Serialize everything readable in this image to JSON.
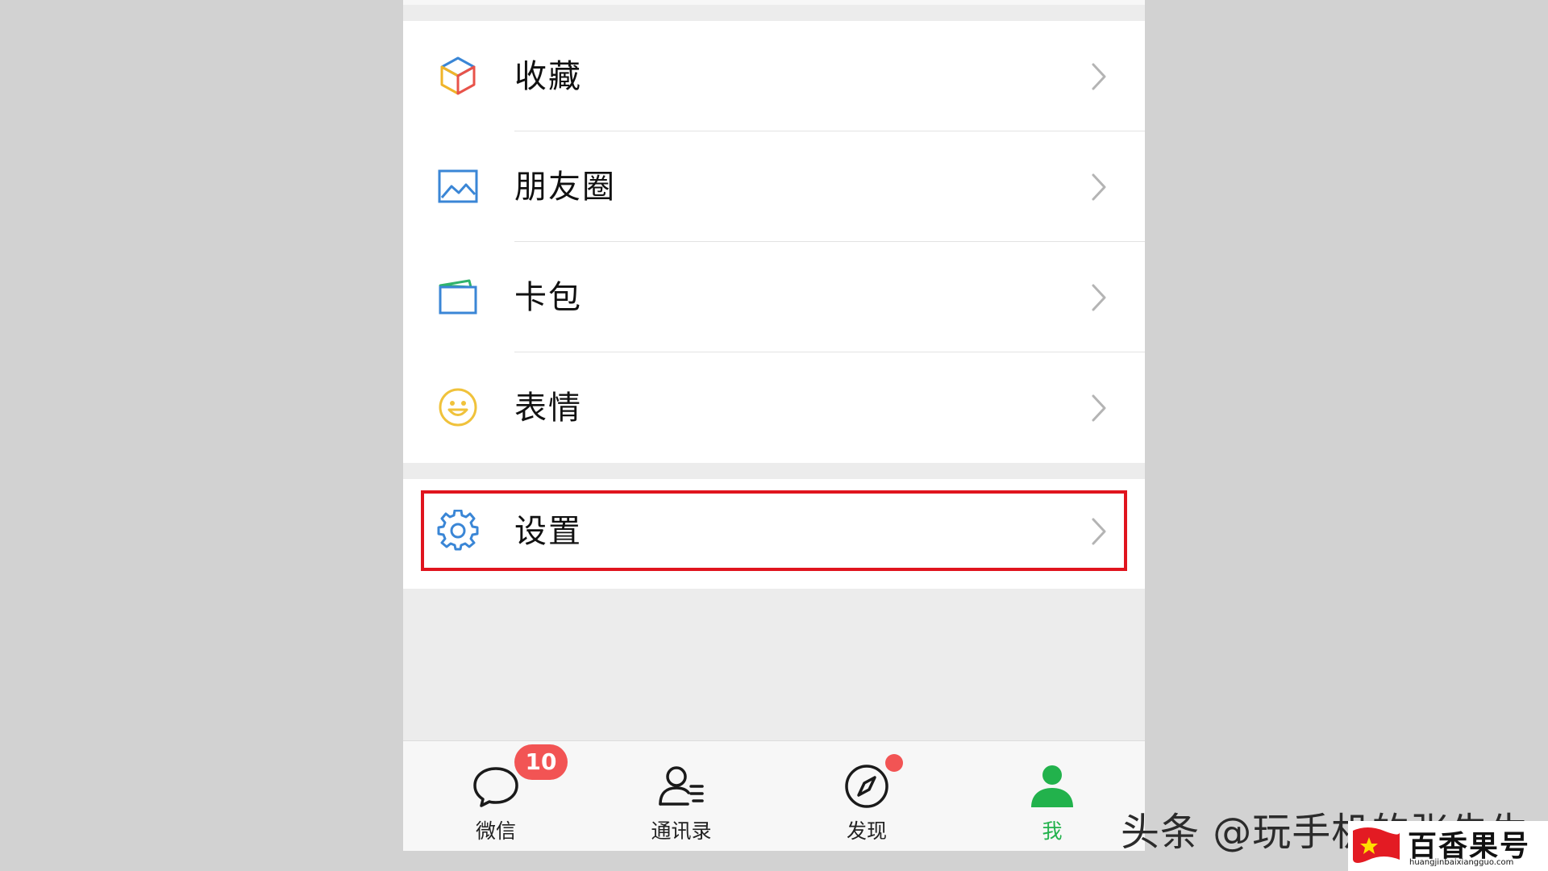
{
  "menu": {
    "items": [
      {
        "label": "收藏",
        "icon": "favorites-cube-icon"
      },
      {
        "label": "朋友圈",
        "icon": "moments-image-icon"
      },
      {
        "label": "卡包",
        "icon": "card-wallet-icon"
      },
      {
        "label": "表情",
        "icon": "sticker-smiley-icon"
      }
    ],
    "settings": {
      "label": "设置",
      "icon": "gear-icon",
      "highlight_color": "#e0141e"
    }
  },
  "tabbar": {
    "tabs": [
      {
        "label": "微信",
        "icon": "chat-bubble-icon",
        "badge": "10"
      },
      {
        "label": "通讯录",
        "icon": "contacts-icon"
      },
      {
        "label": "发现",
        "icon": "compass-icon",
        "dot": true
      },
      {
        "label": "我",
        "icon": "person-icon",
        "active": true
      }
    ],
    "active_color": "#22b24c",
    "badge_color": "#f25454"
  },
  "watermark": {
    "text": "头条 @玩手机的张先生"
  },
  "logo": {
    "name": "百香果号",
    "url": "huangjinbaixiangguo.com"
  }
}
